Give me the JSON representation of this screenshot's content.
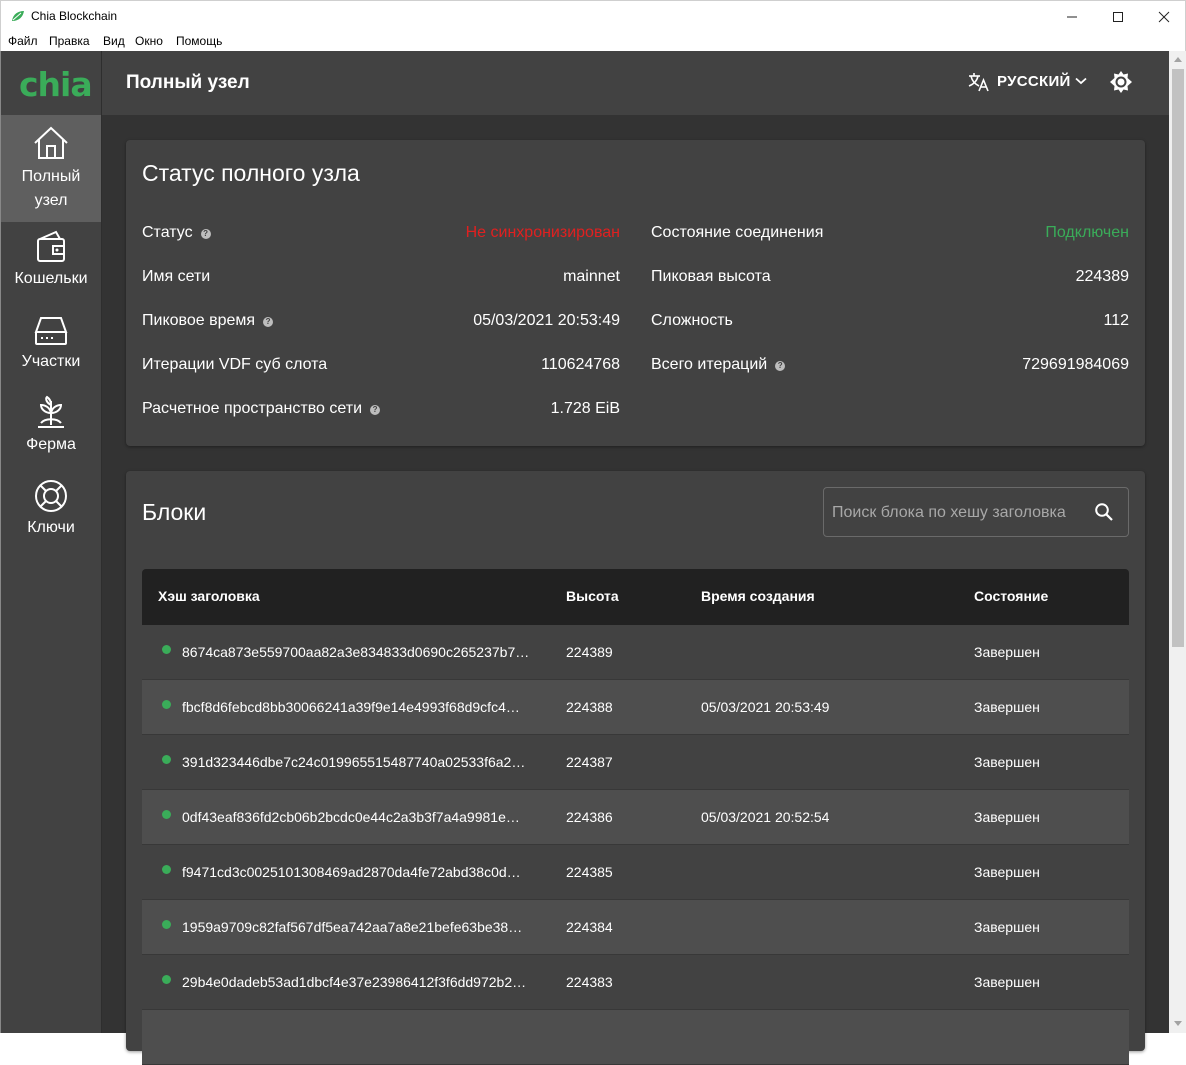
{
  "window": {
    "title": "Chia Blockchain",
    "controls": {
      "minimize": "—",
      "maximize": "☐",
      "close": "✕"
    }
  },
  "menu": [
    "Файл",
    "Правка",
    "Вид",
    "Окно",
    "Помощь"
  ],
  "sidebar": {
    "logo": "chia",
    "items": [
      {
        "label_line1": "Полный",
        "label_line2": "узел",
        "icon": "home-icon",
        "active": true
      },
      {
        "label": "Кошельки",
        "icon": "wallet-icon"
      },
      {
        "label": "Участки",
        "icon": "hard-drive-icon"
      },
      {
        "label": "Ферма",
        "icon": "sprout-icon"
      },
      {
        "label": "Ключи",
        "icon": "lifebuoy-icon"
      }
    ]
  },
  "header": {
    "title": "Полный узел",
    "language": "РУССКИЙ"
  },
  "status": {
    "title": "Статус полного узла",
    "left": [
      {
        "label": "Статус",
        "value": "Не синхронизирован",
        "help": true,
        "color": "#e02020"
      },
      {
        "label": "Имя сети",
        "value": "mainnet",
        "help": false
      },
      {
        "label": "Пиковое время",
        "value": "05/03/2021 20:53:49",
        "help": true
      },
      {
        "label": "Итерации VDF суб слота",
        "value": "110624768",
        "help": false
      },
      {
        "label": "Расчетное пространство сети",
        "value": "1.728 EiB",
        "help": true
      }
    ],
    "right": [
      {
        "label": "Состояние соединения",
        "value": "Подключен",
        "help": false,
        "color": "#3aac59"
      },
      {
        "label": "Пиковая высота",
        "value": "224389",
        "help": false
      },
      {
        "label": "Сложность",
        "value": "112",
        "help": false
      },
      {
        "label": "Всего итераций",
        "value": "729691984069",
        "help": true
      }
    ]
  },
  "blocks": {
    "title": "Блоки",
    "search_placeholder": "Поиск блока по хешу заголовка",
    "columns": [
      "Хэш заголовка",
      "Высота",
      "Время создания",
      "Состояние"
    ],
    "rows": [
      {
        "hash": "8674ca873e559700aa82a3e834833d0690c265237b7…",
        "height": "224389",
        "time": "",
        "state": "Завершен"
      },
      {
        "hash": "fbcf8d6febcd8bb30066241a39f9e14e4993f68d9cfc4…",
        "height": "224388",
        "time": "05/03/2021 20:53:49",
        "state": "Завершен"
      },
      {
        "hash": "391d323446dbe7c24c019965515487740a02533f6a2…",
        "height": "224387",
        "time": "",
        "state": "Завершен"
      },
      {
        "hash": "0df43eaf836fd2cb06b2bcdc0e44c2a3b3f7a4a9981e…",
        "height": "224386",
        "time": "05/03/2021 20:52:54",
        "state": "Завершен"
      },
      {
        "hash": "f9471cd3c0025101308469ad2870da4fe72abd38c0d…",
        "height": "224385",
        "time": "",
        "state": "Завершен"
      },
      {
        "hash": "1959a9709c82faf567df5ea742aa7a8e21befe63be38…",
        "height": "224384",
        "time": "",
        "state": "Завершен"
      },
      {
        "hash": "29b4e0dadeb53ad1dbcf4e37e23986412f3f6dd972b2…",
        "height": "224383",
        "time": "",
        "state": "Завершен"
      },
      {
        "hash": "",
        "height": "",
        "time": "",
        "state": ""
      }
    ]
  },
  "colors": {
    "accent": "#3aac59",
    "error": "#e02020",
    "card": "#424242",
    "background": "#333333"
  }
}
